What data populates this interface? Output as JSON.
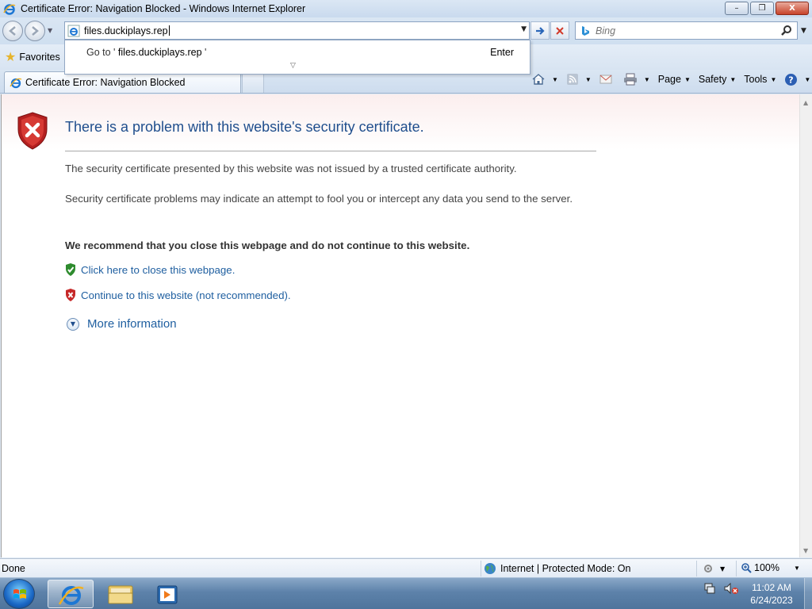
{
  "window": {
    "title": "Certificate Error: Navigation Blocked - Windows Internet Explorer",
    "controls": {
      "minimize": "–",
      "maximize": "❐",
      "close": "X"
    }
  },
  "address": {
    "url": "files.duckiplays.rep"
  },
  "autocomplete": {
    "prefix": "Go to '",
    "query": "files.duckiplays.rep",
    "suffix": "'",
    "enter": "Enter"
  },
  "search": {
    "placeholder": "Bing"
  },
  "favorites": {
    "label": "Favorites"
  },
  "tab": {
    "label": "Certificate Error: Navigation Blocked"
  },
  "commands": {
    "page": "Page",
    "safety": "Safety",
    "tools": "Tools"
  },
  "content": {
    "heading": "There is a problem with this website's security certificate.",
    "p1": "The security certificate presented by this website was not issued by a trusted certificate authority.",
    "p2": "Security certificate problems may indicate an attempt to fool you or intercept any data you send to the server.",
    "recommend": "We recommend that you close this webpage and do not continue to this website.",
    "close_link": "Click here to close this webpage.",
    "continue_link": "Continue to this website (not recommended).",
    "more_info": "More information"
  },
  "status": {
    "text": "Done",
    "zone": "Internet | Protected Mode: On",
    "zoom": "100%"
  },
  "clock": {
    "time": "11:02 AM",
    "date": "6/24/2023"
  },
  "colors": {
    "heading": "#1f4e8d",
    "link": "#1f5fa0",
    "danger": "#c62828",
    "safe": "#2e8b2e"
  }
}
